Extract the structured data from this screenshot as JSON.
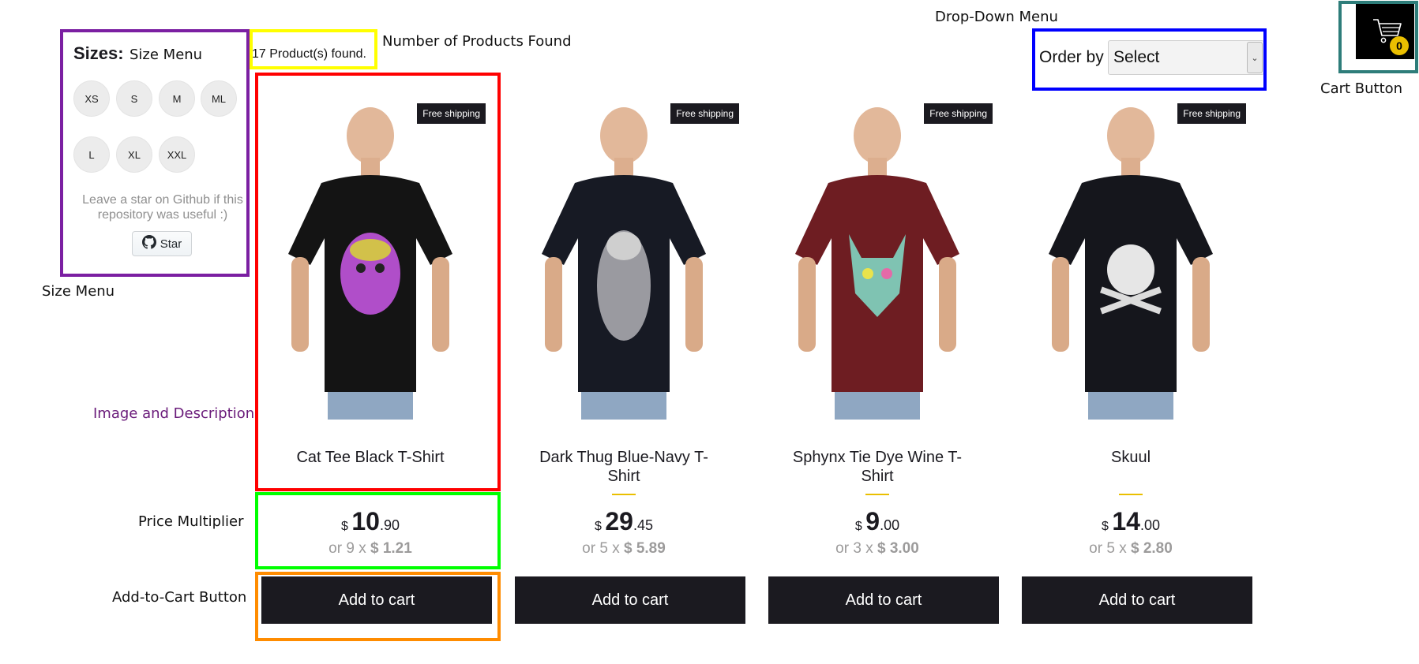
{
  "annotations": {
    "size_menu_top": "Size Menu",
    "size_menu_side": "Size Menu",
    "products_found": "Number of Products Found",
    "dropdown": "Drop-Down Menu",
    "cart_button": "Cart Button",
    "image_description": "Image and Description",
    "price_multiplier": "Price Multiplier",
    "add_to_cart": "Add-to-Cart Button"
  },
  "annotation_colors": {
    "size_menu": "#7b1fa2",
    "products_found": "#ffff00",
    "dropdown": "#0000ff",
    "cart": "#2e7d7a",
    "image_description": "#ff0000",
    "price": "#00ff00",
    "add_to_cart": "#ff8c00"
  },
  "filters": {
    "title": "Sizes:",
    "sizes": [
      "XS",
      "S",
      "M",
      "ML",
      "L",
      "XL",
      "XXL"
    ]
  },
  "github": {
    "note": "Leave a star on Github if this repository was useful :)",
    "star_label": "Star",
    "icon": "github-icon"
  },
  "shelf": {
    "count_text": "17 Product(s) found.",
    "order_label": "Order by",
    "order_selected": "Select"
  },
  "cart": {
    "icon": "cart-icon",
    "count": "0"
  },
  "accent_color": "#eabf00",
  "products": [
    {
      "title": "Cat Tee Black T-Shirt",
      "free_shipping": "Free shipping",
      "currency": "$",
      "price_int": "10",
      "price_dec": ".90",
      "installment_prefix": "or 9 x",
      "installment_value": "$ 1.21",
      "button": "Add to cart",
      "shirt_color": "#141414",
      "print": "skull-cat"
    },
    {
      "title": "Dark Thug Blue-Navy T-Shirt",
      "free_shipping": "Free shipping",
      "currency": "$",
      "price_int": "29",
      "price_dec": ".45",
      "installment_prefix": "or 5 x",
      "installment_value": "$ 5.89",
      "button": "Add to cart",
      "shirt_color": "#171a24",
      "print": "bandana"
    },
    {
      "title": "Sphynx Tie Dye Wine T-Shirt",
      "free_shipping": "Free shipping",
      "currency": "$",
      "price_int": "9",
      "price_dec": ".00",
      "installment_prefix": "or 3 x",
      "installment_value": "$ 3.00",
      "button": "Add to cart",
      "shirt_color": "#6e1d22",
      "print": "sphynx-cat"
    },
    {
      "title": "Skuul",
      "free_shipping": "Free shipping",
      "currency": "$",
      "price_int": "14",
      "price_dec": ".00",
      "installment_prefix": "or 5 x",
      "installment_value": "$ 2.80",
      "button": "Add to cart",
      "shirt_color": "#15161c",
      "print": "skull"
    }
  ]
}
